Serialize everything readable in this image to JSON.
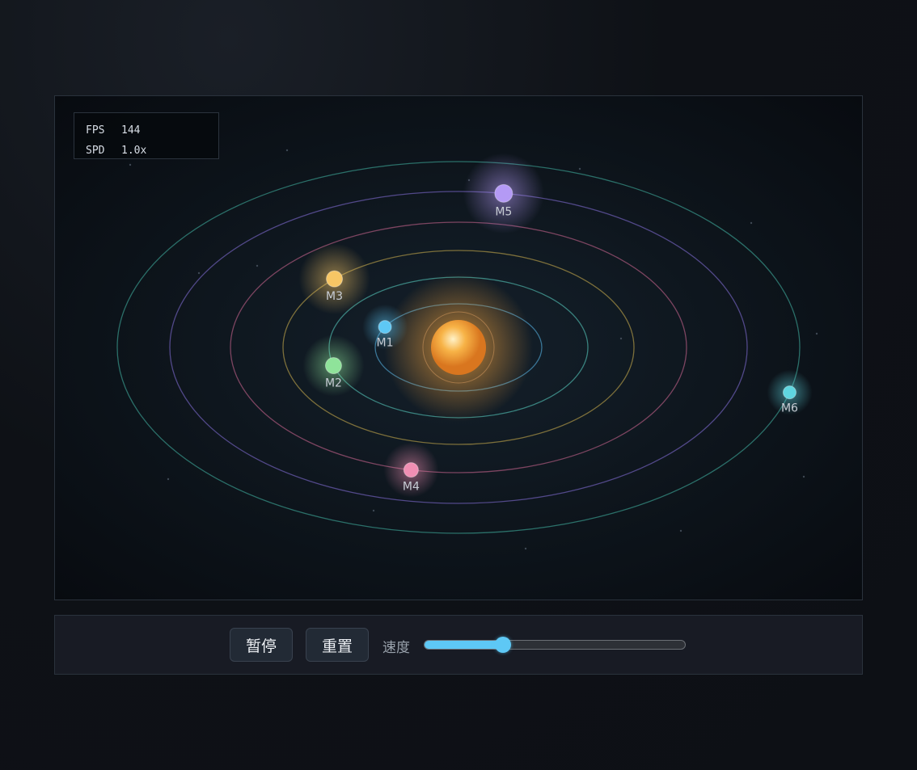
{
  "hud": {
    "fps_label": "FPS",
    "fps_value": "144",
    "speed_label": "SPD",
    "speed_value": "1.0x"
  },
  "orbits": [
    {
      "name": "M1",
      "color": "#5ec8f5",
      "orbit_color": "#3f7fa3"
    },
    {
      "name": "M2",
      "color": "#8fe39a",
      "orbit_color": "#3f8f8a"
    },
    {
      "name": "M3",
      "color": "#f7c665",
      "orbit_color": "#8a7a3e"
    },
    {
      "name": "M4",
      "color": "#f08fb3",
      "orbit_color": "#8a4a68"
    },
    {
      "name": "M5",
      "color": "#b49af5",
      "orbit_color": "#5a4f96"
    },
    {
      "name": "M6",
      "color": "#5fd6e0",
      "orbit_color": "#2f7a72"
    }
  ],
  "sun_color": "#f4a23a",
  "controls": {
    "pause_label": "暂停",
    "reset_label": "重置",
    "speed_label": "速度",
    "speed_value": 0.3
  }
}
